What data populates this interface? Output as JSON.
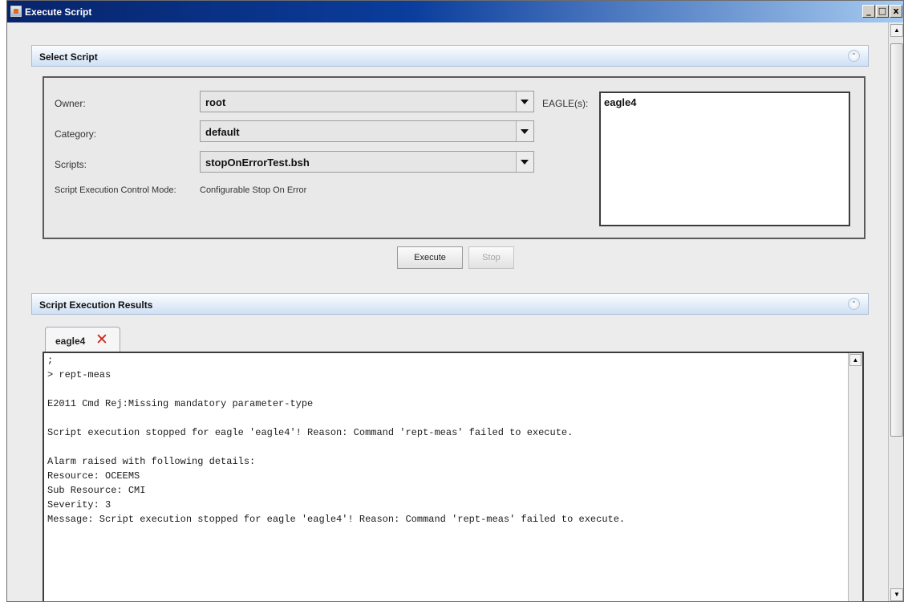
{
  "window": {
    "title": "Execute Script",
    "controls": {
      "minimize": "_",
      "maximize": "□",
      "close": "x"
    }
  },
  "select_script": {
    "header": "Select Script",
    "owner": {
      "label": "Owner:",
      "value": "root"
    },
    "category": {
      "label": "Category:",
      "value": "default"
    },
    "scripts": {
      "label": "Scripts:",
      "value": "stopOnErrorTest.bsh"
    },
    "control_mode": {
      "label": "Script Execution Control Mode:",
      "value": "Configurable Stop On Error"
    },
    "eagles": {
      "label": "EAGLE(s):",
      "items": [
        "eagle4"
      ]
    },
    "execute_label": "Execute",
    "stop_label": "Stop"
  },
  "results": {
    "header": "Script Execution Results",
    "tab_label": "eagle4",
    "tab_close": "✕",
    "output": ";\n> rept-meas\n\nE2011 Cmd Rej:Missing mandatory parameter-type\n\nScript execution stopped for eagle 'eagle4'! Reason: Command 'rept-meas' failed to execute.\n\nAlarm raised with following details:\nResource: OCEEMS\nSub Resource: CMI\nSeverity: 3\nMessage: Script execution stopped for eagle 'eagle4'! Reason: Command 'rept-meas' failed to execute."
  },
  "icons": {
    "collapse": "double-chevron-up-icon",
    "dropdown": "triangle-down-icon"
  },
  "colors": {
    "title_bar": "#0a3d9c",
    "section_header": "#cfe0f4",
    "tab_close": "#d0271f"
  }
}
